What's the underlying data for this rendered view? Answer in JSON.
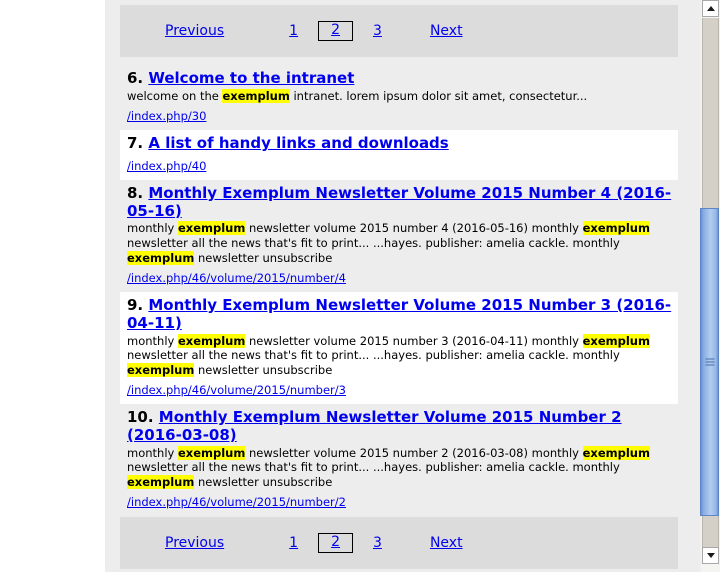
{
  "scrollbar": {
    "up_icon": "chevron-up-icon",
    "down_icon": "chevron-down-icon"
  },
  "pagination": {
    "previous_label": "Previous",
    "next_label": "Next",
    "pages": [
      "1",
      "2",
      "3"
    ],
    "current_page": "2"
  },
  "results": [
    {
      "rank": "6.",
      "title": "Welcome to the intranet",
      "snippet_parts": [
        {
          "text": "welcome on the ",
          "highlight": false
        },
        {
          "text": "exemplum",
          "highlight": true
        },
        {
          "text": " intranet. lorem ipsum dolor sit amet, consectetur...",
          "highlight": false
        }
      ],
      "url": "/index.php/30",
      "background": "gray"
    },
    {
      "rank": "7.",
      "title": "A list of handy links and downloads",
      "snippet_parts": [],
      "url": "/index.php/40",
      "background": "white"
    },
    {
      "rank": "8.",
      "title": "Monthly Exemplum Newsletter Volume 2015 Number 4 (2016-05-16)",
      "snippet_parts": [
        {
          "text": "monthly ",
          "highlight": false
        },
        {
          "text": "exemplum",
          "highlight": true
        },
        {
          "text": " newsletter volume 2015 number 4 (2016-05-16) monthly ",
          "highlight": false
        },
        {
          "text": "exemplum",
          "highlight": true
        },
        {
          "text": " newsletter all the news that's fit to print... ...hayes. publisher: amelia cackle. monthly ",
          "highlight": false
        },
        {
          "text": "exemplum",
          "highlight": true
        },
        {
          "text": " newsletter unsubscribe",
          "highlight": false
        }
      ],
      "url": "/index.php/46/volume/2015/number/4",
      "background": "gray"
    },
    {
      "rank": "9.",
      "title": "Monthly Exemplum Newsletter Volume 2015 Number 3 (2016-04-11)",
      "snippet_parts": [
        {
          "text": "monthly ",
          "highlight": false
        },
        {
          "text": "exemplum",
          "highlight": true
        },
        {
          "text": " newsletter volume 2015 number 3 (2016-04-11) monthly ",
          "highlight": false
        },
        {
          "text": "exemplum",
          "highlight": true
        },
        {
          "text": " newsletter all the news that's fit to print... ...hayes. publisher: amelia cackle. monthly ",
          "highlight": false
        },
        {
          "text": "exemplum",
          "highlight": true
        },
        {
          "text": " newsletter unsubscribe",
          "highlight": false
        }
      ],
      "url": "/index.php/46/volume/2015/number/3",
      "background": "white"
    },
    {
      "rank": "10.",
      "title": "Monthly Exemplum Newsletter Volume 2015 Number 2 (2016-03-08)",
      "snippet_parts": [
        {
          "text": "monthly ",
          "highlight": false
        },
        {
          "text": "exemplum",
          "highlight": true
        },
        {
          "text": " newsletter volume 2015 number 2 (2016-03-08) monthly ",
          "highlight": false
        },
        {
          "text": "exemplum",
          "highlight": true
        },
        {
          "text": " newsletter all the news that's fit to print... ...hayes. publisher: amelia cackle. monthly ",
          "highlight": false
        },
        {
          "text": "exemplum",
          "highlight": true
        },
        {
          "text": " newsletter unsubscribe",
          "highlight": false
        }
      ],
      "url": "/index.php/46/volume/2015/number/2",
      "background": "gray"
    }
  ],
  "colors": {
    "link": "#0000ee",
    "highlight": "#ffff00",
    "pager_background": "#dcdcdc",
    "row_gray": "#ededed",
    "row_white": "#ffffff",
    "scroll_thumb": "#8fb3e5"
  }
}
